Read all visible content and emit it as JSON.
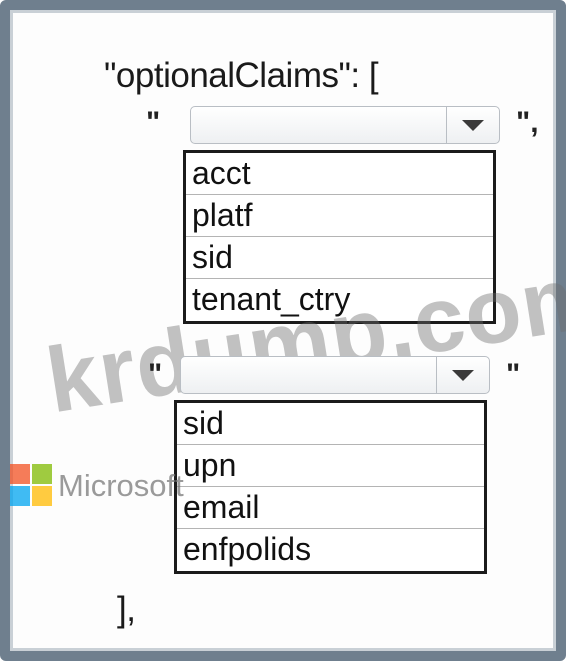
{
  "code": {
    "line1": "\"optionalClaims\": [",
    "closing": "],"
  },
  "first_claim": {
    "open_quote": "\"",
    "close_quote": "\",",
    "options": [
      "acct",
      "platf",
      "sid",
      "tenant_ctry"
    ]
  },
  "second_claim": {
    "open_quote": "\"",
    "close_quote": "\"",
    "options": [
      "sid",
      "upn",
      "email",
      "enfpolids"
    ]
  },
  "watermark": {
    "text": "krdump.com"
  },
  "logo": {
    "text": "Microsoft",
    "colors": [
      "#f25022",
      "#7fba00",
      "#00a4ef",
      "#ffb900"
    ]
  }
}
